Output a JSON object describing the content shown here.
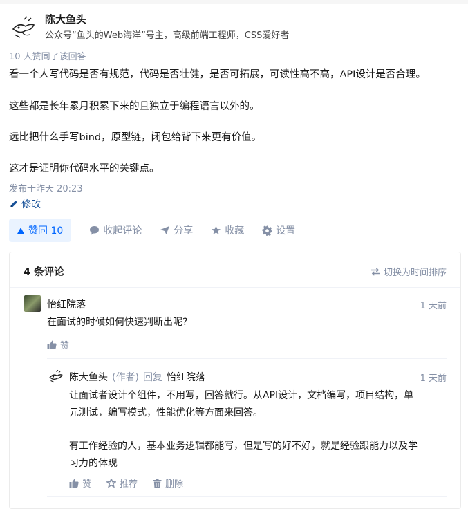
{
  "answer": {
    "author_name": "陈大鱼头",
    "author_bio": "公众号“鱼头的Web海洋”号主，高级前端工程师，CSS爱好者",
    "upvote_summary": "10 人赞同了该回答",
    "paragraphs": [
      "看一个人写代码是否有规范，代码是否壮健，是否可拓展，可读性高不高，API设计是否合理。",
      "这些都是长年累月积累下来的且独立于编程语言以外的。",
      "远比把什么手写bind，原型链，闭包给背下来更有价值。",
      "这才是证明你代码水平的关键点。"
    ],
    "published": "发布于昨天 20:23",
    "edit_label": "修改"
  },
  "actions": {
    "vote_label": "赞同 10",
    "collapse_label": "收起评论",
    "share_label": "分享",
    "collect_label": "收藏",
    "settings_label": "设置"
  },
  "comments": {
    "count_label": "4 条评论",
    "sort_label": "切换为时间排序",
    "items": [
      {
        "author": "怡红院落",
        "time": "1 天前",
        "text": "在面试的时候如何快速判断出呢?",
        "like_label": "赞"
      },
      {
        "author": "陈大鱼头",
        "author_tag": "(作者)",
        "reply_word": "回复",
        "reply_to": "怡红院落",
        "time": "1 天前",
        "text_lines": [
          "让面试者设计个组件，不用写，回答就行。从API设计，文档编写，项目结构，单",
          "元测试，编写模式，性能优化等方面来回答。",
          "有工作经验的人，基本业务逻辑都能写，但是写的好不好，就是经验跟能力以及学",
          "习力的体现"
        ],
        "like_label": "赞",
        "recommend_label": "推荐",
        "delete_label": "删除"
      }
    ]
  },
  "colors": {
    "accent": "#0066ff",
    "vote_bg": "#eaf3ff",
    "meta_gray": "#8590a6",
    "link_blue": "#175199"
  },
  "icons": [
    "fish-avatar-icon",
    "pencil-icon",
    "triangle-up-icon",
    "comment-bubble-icon",
    "paper-plane-icon",
    "star-icon",
    "gear-icon",
    "swap-arrows-icon",
    "thumbs-up-icon",
    "trash-icon"
  ]
}
